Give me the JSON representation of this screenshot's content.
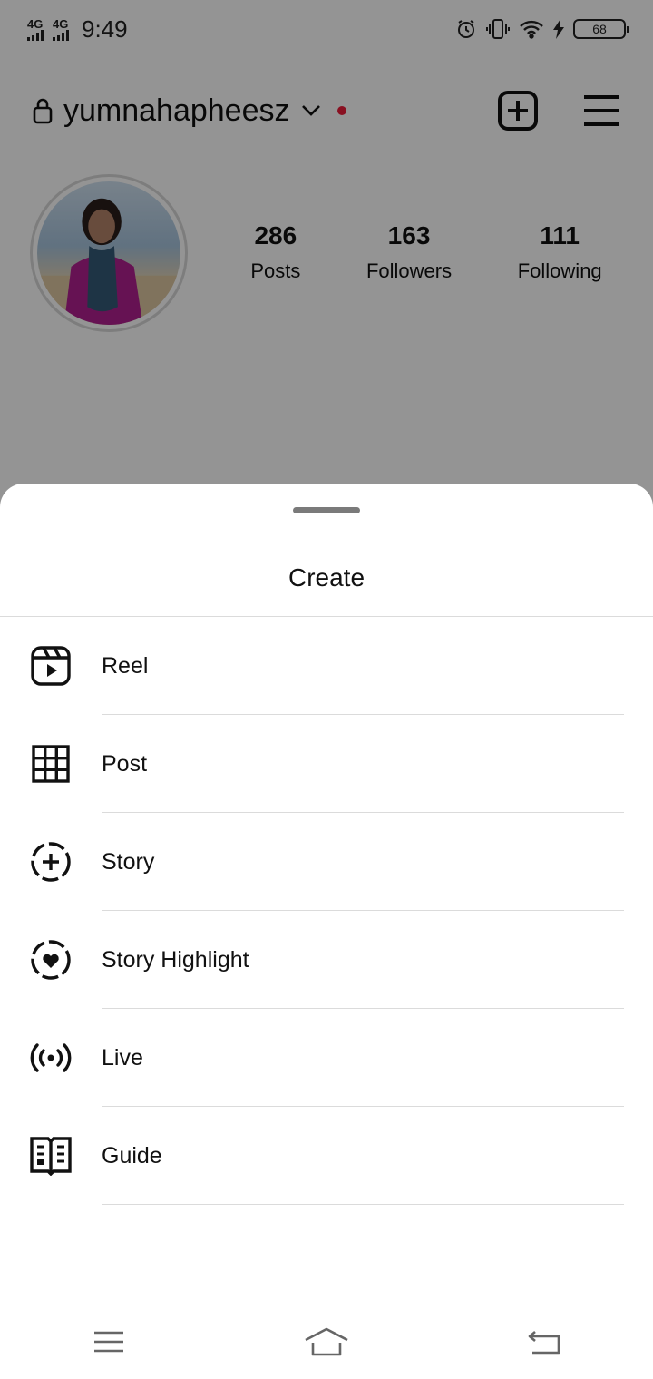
{
  "status_bar": {
    "network_1": "4G",
    "network_2": "4G",
    "time": "9:49",
    "battery": "68"
  },
  "profile": {
    "username": "yumnahapheesz",
    "stats": [
      {
        "value": "286",
        "label": "Posts"
      },
      {
        "value": "163",
        "label": "Followers"
      },
      {
        "value": "111",
        "label": "Following"
      }
    ]
  },
  "sheet": {
    "title": "Create",
    "items": [
      {
        "label": "Reel",
        "icon": "reel-icon"
      },
      {
        "label": "Post",
        "icon": "grid-icon"
      },
      {
        "label": "Story",
        "icon": "story-add-icon"
      },
      {
        "label": "Story Highlight",
        "icon": "story-highlight-icon"
      },
      {
        "label": "Live",
        "icon": "live-icon"
      },
      {
        "label": "Guide",
        "icon": "guide-icon"
      }
    ]
  },
  "colors": {
    "notification_dot": "#ed1d3a",
    "overlay": "rgba(0,0,0,0.42)",
    "divider": "#dbdbdb"
  }
}
